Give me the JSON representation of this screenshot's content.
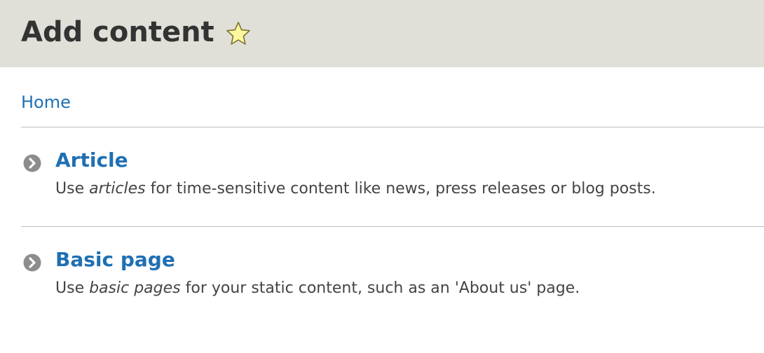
{
  "header": {
    "title": "Add content",
    "shortcut_icon": "star-icon",
    "star_fill": "#fdf8a0",
    "star_stroke": "#7a7431"
  },
  "breadcrumb": {
    "home_label": "Home"
  },
  "content_types": [
    {
      "title": "Article",
      "desc_prefix": "Use ",
      "desc_emphasis": "articles",
      "desc_suffix": " for time-sensitive content like news, press releases or blog posts."
    },
    {
      "title": "Basic page",
      "desc_prefix": "Use ",
      "desc_emphasis": "basic pages",
      "desc_suffix": " for your static content, such as an 'About us' page."
    }
  ],
  "colors": {
    "header_bg": "#e0dfd8",
    "link": "#1f70b3",
    "text": "#444444",
    "divider": "#bfbfba",
    "arrow_circle": "#8c8c8c"
  }
}
